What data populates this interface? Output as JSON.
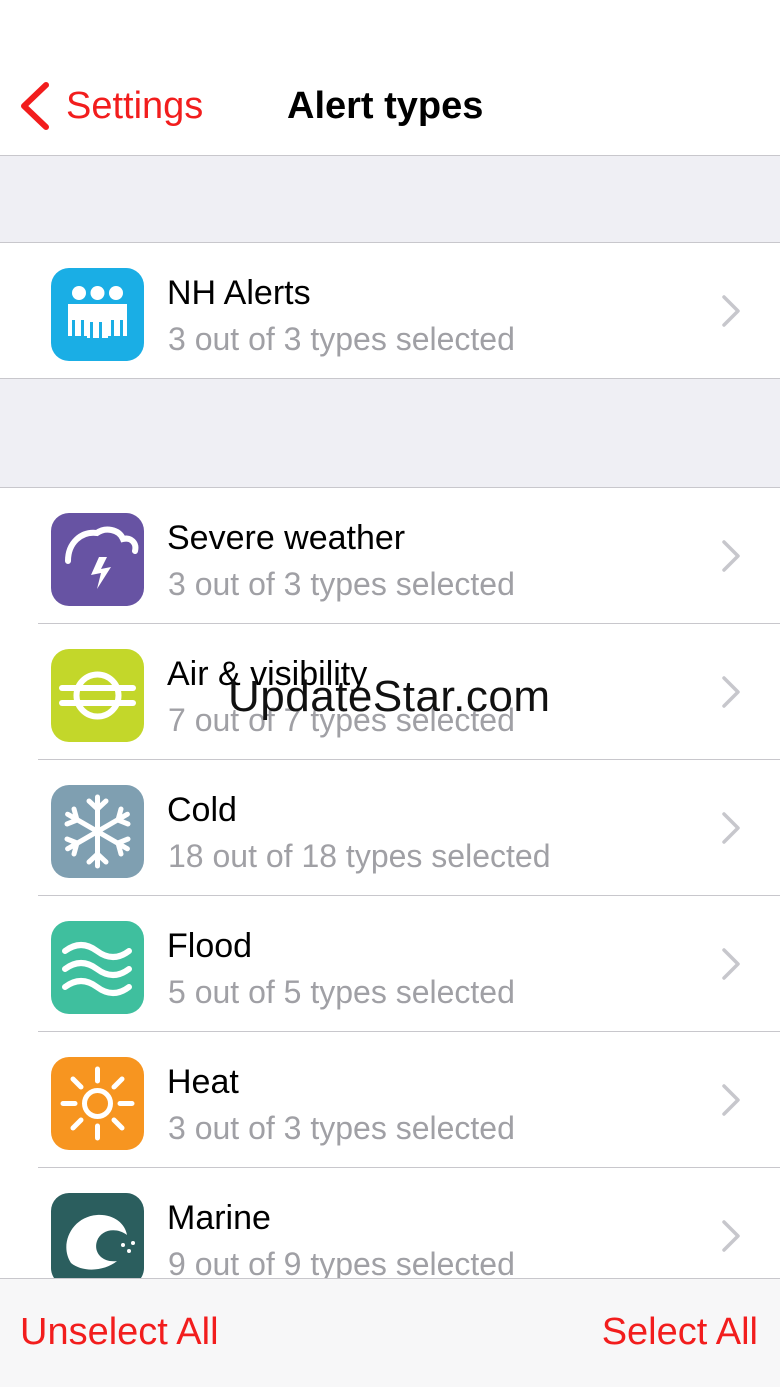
{
  "nav": {
    "back_label": "Settings",
    "title": "Alert types"
  },
  "nh_group": {
    "items": [
      {
        "title": "NH Alerts",
        "subtitle": "3 out of 3 types selected",
        "icon": "people-icon",
        "color": "#1aaee5"
      }
    ]
  },
  "alert_group": {
    "items": [
      {
        "title": "Severe weather",
        "subtitle": "3 out of 3 types selected",
        "icon": "storm-icon",
        "color": "#6753a3"
      },
      {
        "title": "Air & visibility",
        "subtitle": "7 out of 7 types selected",
        "icon": "fog-icon",
        "color": "#c3d72a"
      },
      {
        "title": "Cold",
        "subtitle": "18 out of 18 types selected",
        "icon": "snowflake-icon",
        "color": "#7f9fb1"
      },
      {
        "title": "Flood",
        "subtitle": "5 out of 5 types selected",
        "icon": "waves-icon",
        "color": "#3fbf9e"
      },
      {
        "title": "Heat",
        "subtitle": "3 out of 3 types selected",
        "icon": "sun-icon",
        "color": "#f79520"
      },
      {
        "title": "Marine",
        "subtitle": "9 out of 9 types selected",
        "icon": "wave-icon",
        "color": "#2b5e5e"
      }
    ]
  },
  "watermark": "UpdateStar.com",
  "toolbar": {
    "unselect_label": "Unselect All",
    "select_label": "Select All"
  },
  "colors": {
    "accent": "#f21d1d",
    "background": "#efeff4",
    "separator": "#c8c7cc"
  }
}
